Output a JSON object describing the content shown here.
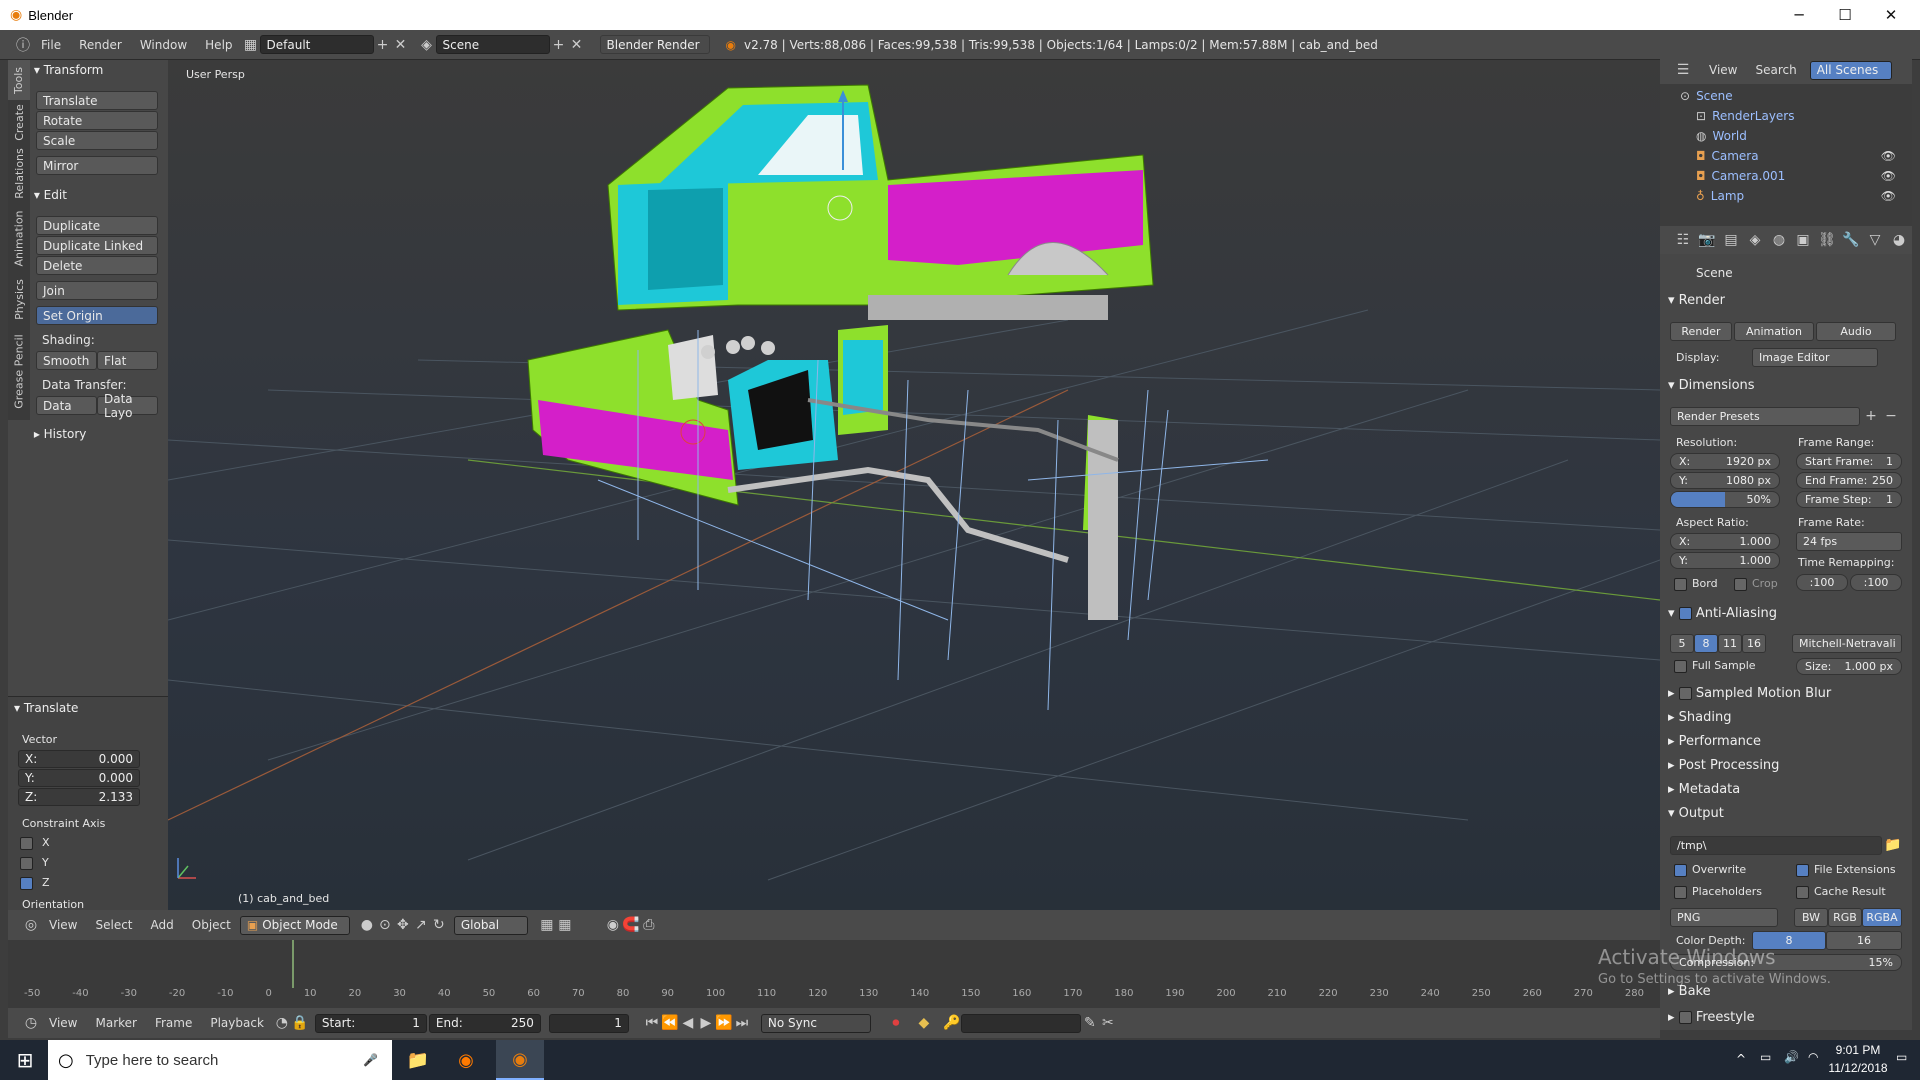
{
  "window": {
    "title": "Blender",
    "minimize": "─",
    "maximize": "☐",
    "close": "✕"
  },
  "infobar": {
    "menus": [
      "File",
      "Render",
      "Window",
      "Help"
    ],
    "layout": "Default",
    "scene": "Scene",
    "engine": "Blender Render",
    "stats": "v2.78 | Verts:88,086 | Faces:99,538 | Tris:99,538 | Objects:1/64 | Lamps:0/2 | Mem:57.88M | cab_and_bed"
  },
  "toolshelf": {
    "tabs": [
      "Tools",
      "Create",
      "Relations",
      "Animation",
      "Physics",
      "Grease Pencil"
    ],
    "transform_header": "Transform",
    "transform_buttons": [
      "Translate",
      "Rotate",
      "Scale",
      "Mirror"
    ],
    "edit_header": "Edit",
    "edit_buttons": [
      "Duplicate",
      "Duplicate Linked",
      "Delete",
      "Join",
      "Set Origin"
    ],
    "shading_label": "Shading:",
    "smooth": "Smooth",
    "flat": "Flat",
    "data_transfer_label": "Data Transfer:",
    "data": "Data",
    "data_layo": "Data Layo",
    "history_header": "History"
  },
  "operator": {
    "header": "Translate",
    "vector_label": "Vector",
    "x_label": "X:",
    "x": "0.000",
    "y_label": "Y:",
    "y": "0.000",
    "z_label": "Z:",
    "z": "2.133",
    "constraint_label": "Constraint Axis",
    "cx": "X",
    "cy": "Y",
    "cz": "Z",
    "orientation_label": "Orientation"
  },
  "viewport": {
    "view_label": "User Persp",
    "object_label": "(1) cab_and_bed"
  },
  "header3d": {
    "menus": [
      "View",
      "Select",
      "Add",
      "Object"
    ],
    "mode": "Object Mode",
    "orientation": "Global"
  },
  "timeline": {
    "ticks": [
      "-50",
      "-40",
      "-30",
      "-20",
      "-10",
      "0",
      "10",
      "20",
      "30",
      "40",
      "50",
      "60",
      "70",
      "80",
      "90",
      "100",
      "110",
      "120",
      "130",
      "140",
      "150",
      "160",
      "170",
      "180",
      "190",
      "200",
      "210",
      "220",
      "230",
      "240",
      "250",
      "260",
      "270",
      "280"
    ],
    "menus": [
      "View",
      "Marker",
      "Frame",
      "Playback"
    ],
    "start_label": "Start:",
    "start": "1",
    "end_label": "End:",
    "end": "250",
    "current": "1",
    "sync": "No Sync"
  },
  "outliner": {
    "view": "View",
    "search": "Search",
    "scope": "All Scenes",
    "rows": [
      "Scene",
      "RenderLayers",
      "World",
      "Camera",
      "Camera.001",
      "Lamp"
    ]
  },
  "properties": {
    "context": "Scene",
    "render_header": "Render",
    "render_btn": "Render",
    "animation_btn": "Animation",
    "audio_btn": "Audio",
    "display_label": "Display:",
    "display": "Image Editor",
    "dimensions_header": "Dimensions",
    "presets": "Render Presets",
    "resolution_label": "Resolution:",
    "res_x_label": "X:",
    "res_x": "1920 px",
    "res_y_label": "Y:",
    "res_y": "1080 px",
    "res_pct": "50%",
    "res_pct_value": 0.5,
    "frame_range_label": "Frame Range:",
    "start_frame_label": "Start Frame:",
    "start_frame": "1",
    "end_frame_label": "End Frame:",
    "end_frame": "250",
    "frame_step_label": "Frame Step:",
    "frame_step": "1",
    "aspect_label": "Aspect Ratio:",
    "asp_x_label": "X:",
    "asp_x": "1.000",
    "asp_y_label": "Y:",
    "asp_y": "1.000",
    "frame_rate_label": "Frame Rate:",
    "fps": "24 fps",
    "remap_label": "Time Remapping:",
    "remap_old": ":100",
    "remap_new": ":100",
    "bord": "Bord",
    "crop": "Crop",
    "aa_header": "Anti-Aliasing",
    "aa_samples": [
      "5",
      "8",
      "11",
      "16"
    ],
    "aa_filter": "Mitchell-Netravali",
    "full_sample": "Full Sample",
    "size_label": "Size:",
    "size": "1.000 px",
    "collapsed": [
      "Sampled Motion Blur",
      "Shading",
      "Performance",
      "Post Processing",
      "Metadata"
    ],
    "output_header": "Output",
    "path": "/tmp\\",
    "overwrite": "Overwrite",
    "file_ext": "File Extensions",
    "placeholders": "Placeholders",
    "cache_result": "Cache Result",
    "format": "PNG",
    "bw": "BW",
    "rgb": "RGB",
    "rgba": "RGBA",
    "color_depth_label": "Color Depth:",
    "depth8": "8",
    "depth16": "16",
    "compression_label": "Compression:",
    "compression": "15%",
    "bake": "Bake",
    "freestyle": "Freestyle"
  },
  "watermark": {
    "line1": "Activate Windows",
    "line2": "Go to Settings to activate Windows."
  },
  "taskbar": {
    "search": "Type here to search",
    "time": "9:01 PM",
    "date": "11/12/2018"
  },
  "colors": {
    "accent": "#5680c2",
    "truck_green": "#8ee02c",
    "truck_magenta": "#d41fc9",
    "truck_cyan": "#1ec8d8"
  }
}
